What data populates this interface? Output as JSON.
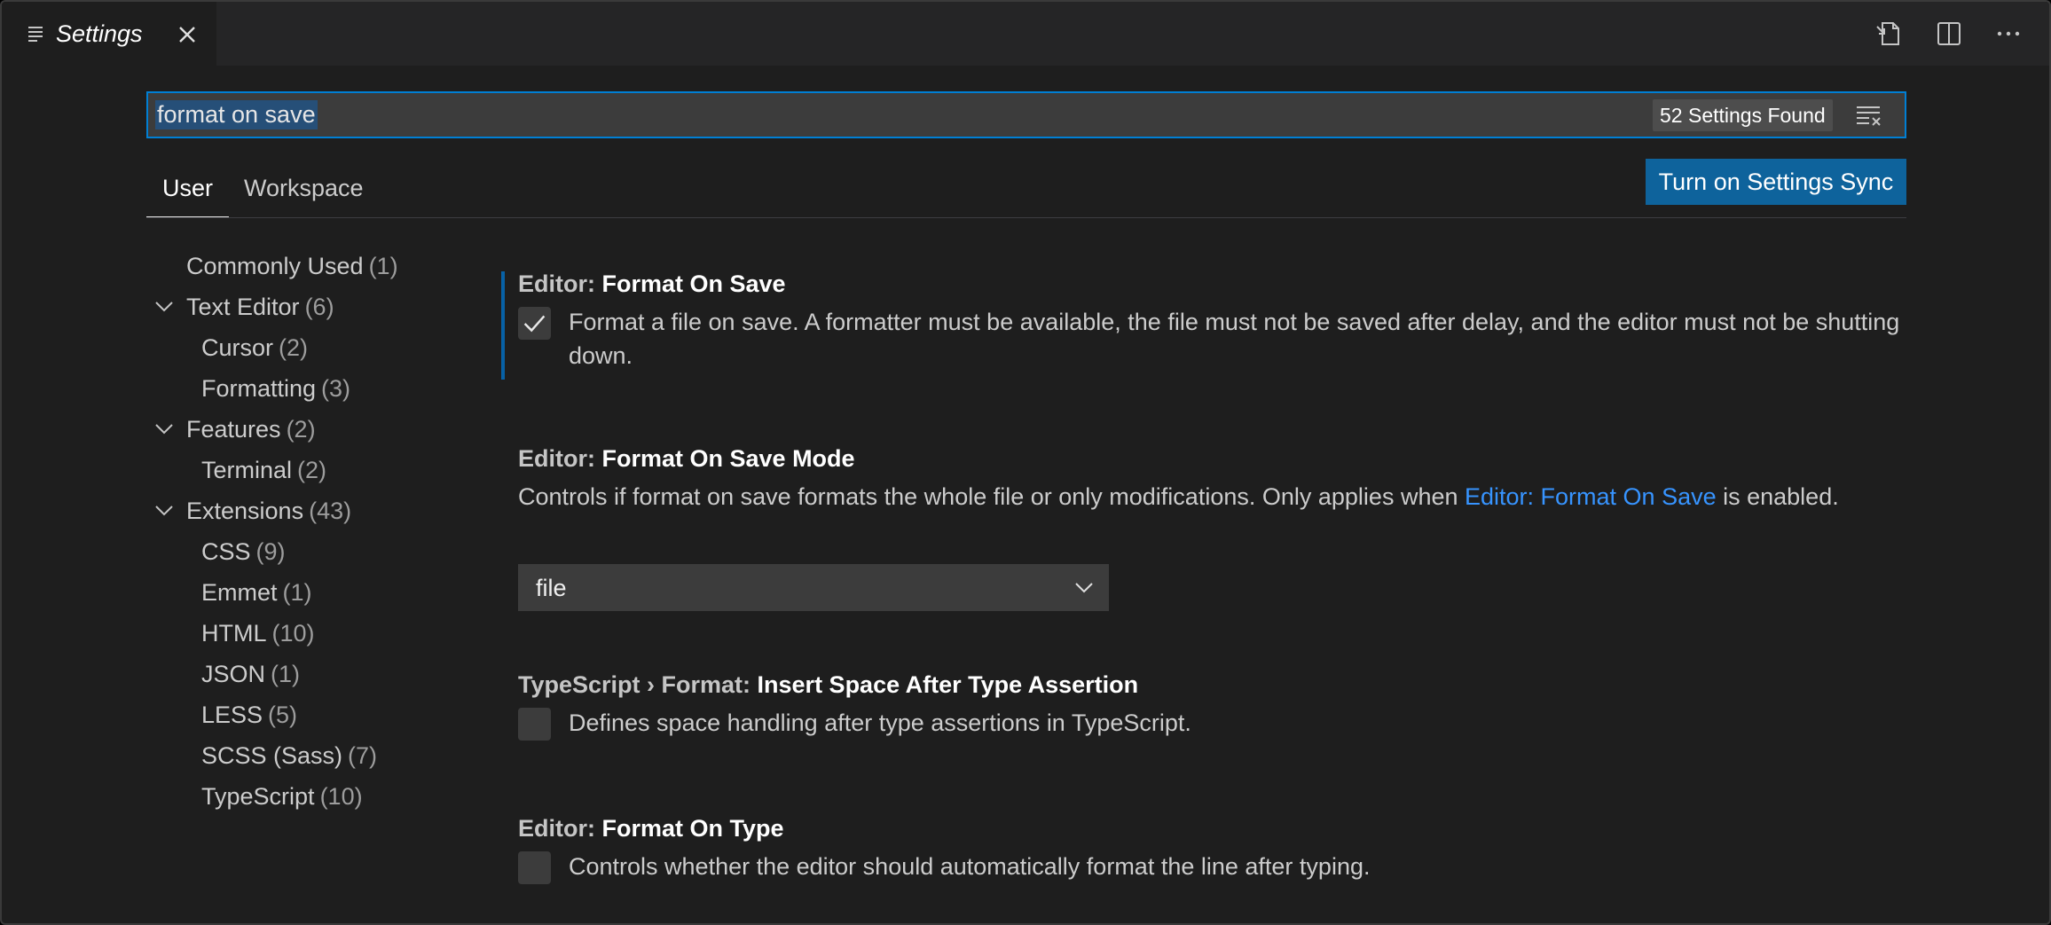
{
  "tab": {
    "title": "Settings"
  },
  "search": {
    "value": "format on save",
    "results_badge": "52 Settings Found"
  },
  "scopes": {
    "user": "User",
    "workspace": "Workspace",
    "active": "User"
  },
  "sync_button": "Turn on Settings Sync",
  "toc": [
    {
      "label": "Commonly Used",
      "count": "(1)",
      "level": 0,
      "expandable": false
    },
    {
      "label": "Text Editor",
      "count": "(6)",
      "level": 0,
      "expandable": true
    },
    {
      "label": "Cursor",
      "count": "(2)",
      "level": 1,
      "expandable": false
    },
    {
      "label": "Formatting",
      "count": "(3)",
      "level": 1,
      "expandable": false
    },
    {
      "label": "Features",
      "count": "(2)",
      "level": 0,
      "expandable": true
    },
    {
      "label": "Terminal",
      "count": "(2)",
      "level": 1,
      "expandable": false
    },
    {
      "label": "Extensions",
      "count": "(43)",
      "level": 0,
      "expandable": true
    },
    {
      "label": "CSS",
      "count": "(9)",
      "level": 1,
      "expandable": false
    },
    {
      "label": "Emmet",
      "count": "(1)",
      "level": 1,
      "expandable": false
    },
    {
      "label": "HTML",
      "count": "(10)",
      "level": 1,
      "expandable": false
    },
    {
      "label": "JSON",
      "count": "(1)",
      "level": 1,
      "expandable": false
    },
    {
      "label": "LESS",
      "count": "(5)",
      "level": 1,
      "expandable": false
    },
    {
      "label": "SCSS (Sass)",
      "count": "(7)",
      "level": 1,
      "expandable": false
    },
    {
      "label": "TypeScript",
      "count": "(10)",
      "level": 1,
      "expandable": false
    }
  ],
  "settings": {
    "format_on_save": {
      "category": "Editor: ",
      "name": "Format On Save",
      "description": "Format a file on save. A formatter must be available, the file must not be saved after delay, and the editor must not be shutting down.",
      "checked": true
    },
    "format_on_save_mode": {
      "category": "Editor: ",
      "name": "Format On Save Mode",
      "description_pre": "Controls if format on save formats the whole file or only modifications. Only applies when ",
      "description_link": "Editor: Format On Save",
      "description_post": " is enabled.",
      "value": "file"
    },
    "ts_insert_space": {
      "category": "TypeScript › Format: ",
      "name": "Insert Space After Type Assertion",
      "description": "Defines space handling after type assertions in TypeScript.",
      "checked": false
    },
    "format_on_type": {
      "category": "Editor: ",
      "name": "Format On Type",
      "description": "Controls whether the editor should automatically format the line after typing.",
      "checked": false
    }
  },
  "colors": {
    "accent": "#007fd4",
    "button": "#0e639c",
    "link": "#3794ff",
    "background": "#1e1e1e"
  },
  "icons": {
    "tab": "list-icon",
    "close": "close-icon",
    "open_json": "open-json-icon",
    "split": "split-editor-icon",
    "more": "more-actions-icon",
    "clear_filter": "clear-filter-icon",
    "chevron": "chevron-down-icon",
    "check": "check-icon"
  }
}
